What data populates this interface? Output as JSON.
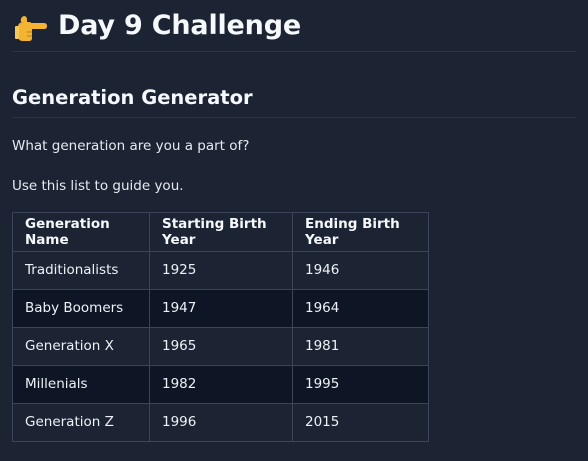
{
  "heading": {
    "icon": "pointing-hand-icon",
    "title": "Day 9 Challenge"
  },
  "section": {
    "title": "Generation Generator"
  },
  "paragraphs": {
    "question": "What generation are you a part of?",
    "guide": "Use this list to guide you."
  },
  "table": {
    "headers": [
      "Generation Name",
      "Starting Birth Year",
      "Ending Birth Year"
    ],
    "rows": [
      [
        "Traditionalists",
        "1925",
        "1946"
      ],
      [
        "Baby Boomers",
        "1947",
        "1964"
      ],
      [
        "Generation X",
        "1965",
        "1981"
      ],
      [
        "Millenials",
        "1982",
        "1995"
      ],
      [
        "Generation Z",
        "1996",
        "2015"
      ]
    ]
  },
  "colors": {
    "background": "#1c2333",
    "alt_row": "#0e1525",
    "border": "#3c445c",
    "text": "#f5f9fc",
    "emoji_yellow": "#f4b433"
  }
}
